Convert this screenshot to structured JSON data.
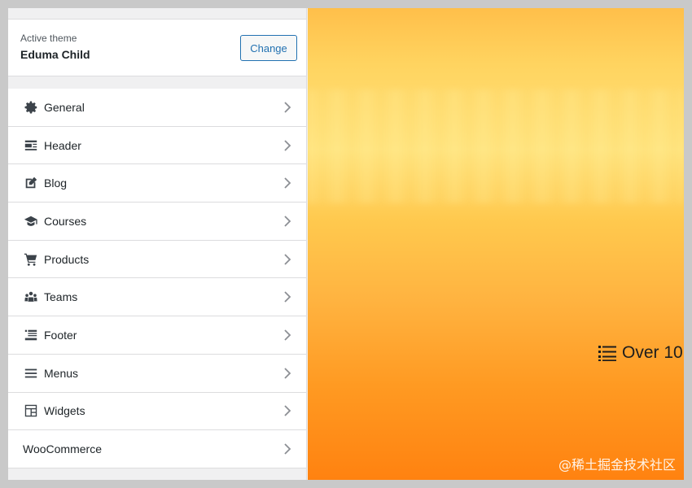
{
  "theme": {
    "label": "Active theme",
    "name": "Eduma Child",
    "change_label": "Change"
  },
  "menu": {
    "items": [
      {
        "label": "General",
        "icon": "gear-icon"
      },
      {
        "label": "Header",
        "icon": "header-icon"
      },
      {
        "label": "Blog",
        "icon": "edit-icon"
      },
      {
        "label": "Courses",
        "icon": "graduation-cap-icon"
      },
      {
        "label": "Products",
        "icon": "cart-icon"
      },
      {
        "label": "Teams",
        "icon": "groups-icon"
      },
      {
        "label": "Footer",
        "icon": "footer-icon"
      },
      {
        "label": "Menus",
        "icon": "menu-icon"
      },
      {
        "label": "Widgets",
        "icon": "widgets-icon"
      },
      {
        "label": "WooCommerce",
        "icon": ""
      }
    ]
  },
  "preview": {
    "overlay_text": "Over 10",
    "overlay_icon": "list-icon",
    "watermark": "@稀土掘金技术社区"
  },
  "colors": {
    "accent": "#2271b1",
    "preview_top": "#ffbf4a",
    "preview_bottom": "#ff8210"
  }
}
